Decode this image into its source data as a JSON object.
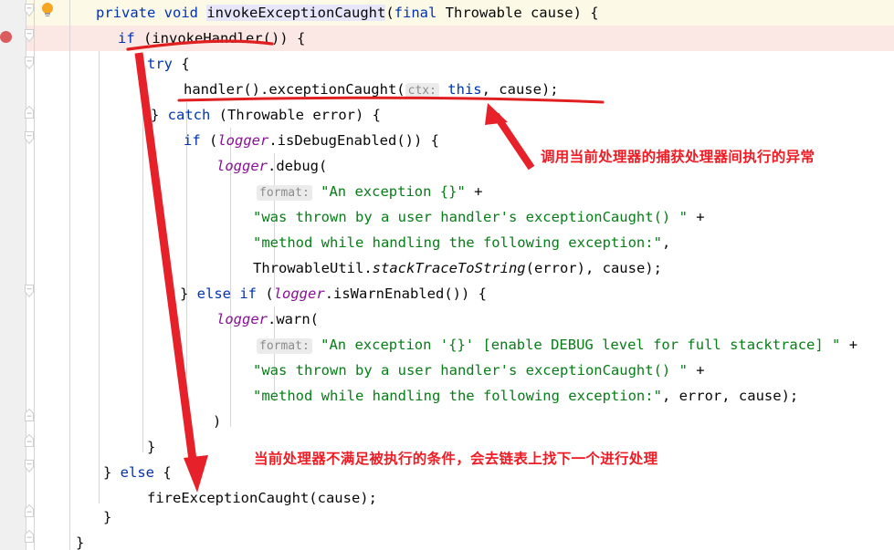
{
  "editor": {
    "app": "code-editor",
    "language": "java",
    "colors": {
      "keyword": "#0033B3",
      "string": "#067D17",
      "field": "#871094",
      "text": "#080808",
      "hint_text": "#8C8C8C",
      "hint_bg": "#EBEBEB",
      "gutter_bg": "#F0F0F0",
      "caret_row": "#FCFAE7",
      "breakpoint_row": "#FBE8E5",
      "breakpoint_dot": "#DB5C5C",
      "annotation_red": "#EE1C25",
      "bulb": "#F5A623",
      "indent_guide": "#D6D6D6",
      "method_decl_bg": "#E7E6FA"
    },
    "gutter": {
      "breakpoint_icon": "breakpoint-dot-icon",
      "intention_icon": "lightbulb-icon",
      "fold_expanded_icon": "fold-expanded-chevron-icon",
      "fold_collapsed_icon": "fold-region-icon"
    },
    "lines": [
      {
        "n": 1,
        "indent": 1,
        "text": "private void invokeExceptionCaught(final Throwable cause) {"
      },
      {
        "n": 2,
        "indent": 2,
        "text": "if (invokeHandler()) {"
      },
      {
        "n": 3,
        "indent": 3,
        "text": "try {"
      },
      {
        "n": 4,
        "indent": 4,
        "text": "handler().exceptionCaught( ctx: this, cause);"
      },
      {
        "n": 5,
        "indent": 3,
        "text": "} catch (Throwable error) {"
      },
      {
        "n": 6,
        "indent": 4,
        "text": "if (logger.isDebugEnabled()) {"
      },
      {
        "n": 7,
        "indent": 5,
        "text": "logger.debug("
      },
      {
        "n": 8,
        "indent": 6,
        "text": "format: \"An exception {}\" +"
      },
      {
        "n": 9,
        "indent": 6,
        "text": "\"was thrown by a user handler's exceptionCaught() \" +"
      },
      {
        "n": 10,
        "indent": 6,
        "text": "\"method while handling the following exception:\","
      },
      {
        "n": 11,
        "indent": 6,
        "text": "ThrowableUtil.stackTraceToString(error), cause);"
      },
      {
        "n": 12,
        "indent": 4,
        "text": "} else if (logger.isWarnEnabled()) {"
      },
      {
        "n": 13,
        "indent": 5,
        "text": "logger.warn("
      },
      {
        "n": 14,
        "indent": 6,
        "text": "format: \"An exception '{}' [enable DEBUG level for full stacktrace] \" +"
      },
      {
        "n": 15,
        "indent": 6,
        "text": "\"was thrown by a user handler's exceptionCaught() \" +"
      },
      {
        "n": 16,
        "indent": 6,
        "text": "\"method while handling the following exception:\", error, cause);"
      },
      {
        "n": 17,
        "indent": 5,
        "text": ")"
      },
      {
        "n": 18,
        "indent": 4,
        "text": "}"
      },
      {
        "n": 19,
        "indent": 2,
        "text": "} else {"
      },
      {
        "n": 20,
        "indent": 3,
        "text": "fireExceptionCaught(cause);"
      },
      {
        "n": 21,
        "indent": 2,
        "text": "}"
      },
      {
        "n": 22,
        "indent": 1,
        "text": "}"
      }
    ],
    "inlay_hints": [
      {
        "label": "ctx:",
        "line": 4
      },
      {
        "label": "format:",
        "line": 8
      },
      {
        "label": "format:",
        "line": 14
      }
    ]
  },
  "annotations": [
    {
      "id": "note-exception-caught",
      "text": "调用当前处理器的捕获处理器间执行的异常",
      "arrow": "arrow-up-left",
      "points_to": "handler().exceptionCaught( ctx: this, cause);"
    },
    {
      "id": "note-fire-exception-caught",
      "text": "当前处理器不满足被执行的条件，会去链表上找下一个进行处理",
      "arrow": "arrow-down",
      "points_to": "fireExceptionCaught(cause);"
    }
  ],
  "underlines": [
    {
      "id": "underline-invoke-handler",
      "target": "if (invokeHandler()) {"
    },
    {
      "id": "underline-exception-caught",
      "target": "handler().exceptionCaught( ctx: this, cause);"
    }
  ]
}
